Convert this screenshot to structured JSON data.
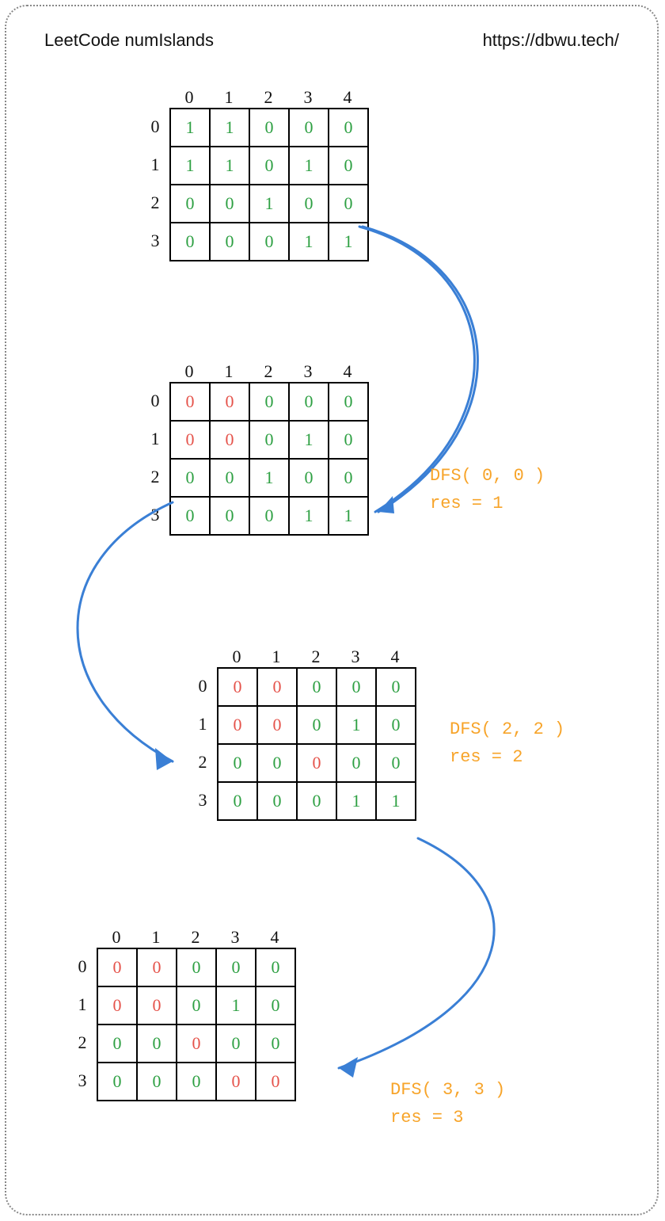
{
  "header": {
    "title": "LeetCode numIslands",
    "url": "https://dbwu.tech/"
  },
  "col_labels": [
    "0",
    "1",
    "2",
    "3",
    "4"
  ],
  "row_labels": [
    "0",
    "1",
    "2",
    "3"
  ],
  "grids": [
    {
      "cells": [
        [
          {
            "v": "1",
            "c": "green"
          },
          {
            "v": "1",
            "c": "green"
          },
          {
            "v": "0",
            "c": "green"
          },
          {
            "v": "0",
            "c": "green"
          },
          {
            "v": "0",
            "c": "green"
          }
        ],
        [
          {
            "v": "1",
            "c": "green"
          },
          {
            "v": "1",
            "c": "green"
          },
          {
            "v": "0",
            "c": "green"
          },
          {
            "v": "1",
            "c": "green"
          },
          {
            "v": "0",
            "c": "green"
          }
        ],
        [
          {
            "v": "0",
            "c": "green"
          },
          {
            "v": "0",
            "c": "green"
          },
          {
            "v": "1",
            "c": "green"
          },
          {
            "v": "0",
            "c": "green"
          },
          {
            "v": "0",
            "c": "green"
          }
        ],
        [
          {
            "v": "0",
            "c": "green"
          },
          {
            "v": "0",
            "c": "green"
          },
          {
            "v": "0",
            "c": "green"
          },
          {
            "v": "1",
            "c": "green"
          },
          {
            "v": "1",
            "c": "green"
          }
        ]
      ]
    },
    {
      "cells": [
        [
          {
            "v": "0",
            "c": "red"
          },
          {
            "v": "0",
            "c": "red"
          },
          {
            "v": "0",
            "c": "green"
          },
          {
            "v": "0",
            "c": "green"
          },
          {
            "v": "0",
            "c": "green"
          }
        ],
        [
          {
            "v": "0",
            "c": "red"
          },
          {
            "v": "0",
            "c": "red"
          },
          {
            "v": "0",
            "c": "green"
          },
          {
            "v": "1",
            "c": "green"
          },
          {
            "v": "0",
            "c": "green"
          }
        ],
        [
          {
            "v": "0",
            "c": "green"
          },
          {
            "v": "0",
            "c": "green"
          },
          {
            "v": "1",
            "c": "green"
          },
          {
            "v": "0",
            "c": "green"
          },
          {
            "v": "0",
            "c": "green"
          }
        ],
        [
          {
            "v": "0",
            "c": "green"
          },
          {
            "v": "0",
            "c": "green"
          },
          {
            "v": "0",
            "c": "green"
          },
          {
            "v": "1",
            "c": "green"
          },
          {
            "v": "1",
            "c": "green"
          }
        ]
      ]
    },
    {
      "cells": [
        [
          {
            "v": "0",
            "c": "red"
          },
          {
            "v": "0",
            "c": "red"
          },
          {
            "v": "0",
            "c": "green"
          },
          {
            "v": "0",
            "c": "green"
          },
          {
            "v": "0",
            "c": "green"
          }
        ],
        [
          {
            "v": "0",
            "c": "red"
          },
          {
            "v": "0",
            "c": "red"
          },
          {
            "v": "0",
            "c": "green"
          },
          {
            "v": "1",
            "c": "green"
          },
          {
            "v": "0",
            "c": "green"
          }
        ],
        [
          {
            "v": "0",
            "c": "green"
          },
          {
            "v": "0",
            "c": "green"
          },
          {
            "v": "0",
            "c": "red"
          },
          {
            "v": "0",
            "c": "green"
          },
          {
            "v": "0",
            "c": "green"
          }
        ],
        [
          {
            "v": "0",
            "c": "green"
          },
          {
            "v": "0",
            "c": "green"
          },
          {
            "v": "0",
            "c": "green"
          },
          {
            "v": "1",
            "c": "green"
          },
          {
            "v": "1",
            "c": "green"
          }
        ]
      ]
    },
    {
      "cells": [
        [
          {
            "v": "0",
            "c": "red"
          },
          {
            "v": "0",
            "c": "red"
          },
          {
            "v": "0",
            "c": "green"
          },
          {
            "v": "0",
            "c": "green"
          },
          {
            "v": "0",
            "c": "green"
          }
        ],
        [
          {
            "v": "0",
            "c": "red"
          },
          {
            "v": "0",
            "c": "red"
          },
          {
            "v": "0",
            "c": "green"
          },
          {
            "v": "1",
            "c": "green"
          },
          {
            "v": "0",
            "c": "green"
          }
        ],
        [
          {
            "v": "0",
            "c": "green"
          },
          {
            "v": "0",
            "c": "green"
          },
          {
            "v": "0",
            "c": "red"
          },
          {
            "v": "0",
            "c": "green"
          },
          {
            "v": "0",
            "c": "green"
          }
        ],
        [
          {
            "v": "0",
            "c": "green"
          },
          {
            "v": "0",
            "c": "green"
          },
          {
            "v": "0",
            "c": "green"
          },
          {
            "v": "0",
            "c": "red"
          },
          {
            "v": "0",
            "c": "red"
          }
        ]
      ]
    }
  ],
  "annotations": [
    {
      "call": "DFS( 0, 0 )",
      "result": "res = 1"
    },
    {
      "call": "DFS( 2, 2 )",
      "result": "res = 2"
    },
    {
      "call": "DFS( 3, 3 )",
      "result": "res = 3"
    }
  ],
  "chart_data": {
    "type": "diagram",
    "algorithm": "DFS island counting",
    "rows": 4,
    "cols": 5,
    "steps": [
      {
        "start_cell": [
          0,
          0
        ],
        "visited_becomes_zero": [
          [
            0,
            0
          ],
          [
            0,
            1
          ],
          [
            1,
            0
          ],
          [
            1,
            1
          ]
        ],
        "res_after": 1
      },
      {
        "start_cell": [
          2,
          2
        ],
        "visited_becomes_zero": [
          [
            2,
            2
          ]
        ],
        "res_after": 2
      },
      {
        "start_cell": [
          3,
          3
        ],
        "visited_becomes_zero": [
          [
            3,
            3
          ],
          [
            3,
            4
          ]
        ],
        "res_after": 3
      }
    ]
  }
}
